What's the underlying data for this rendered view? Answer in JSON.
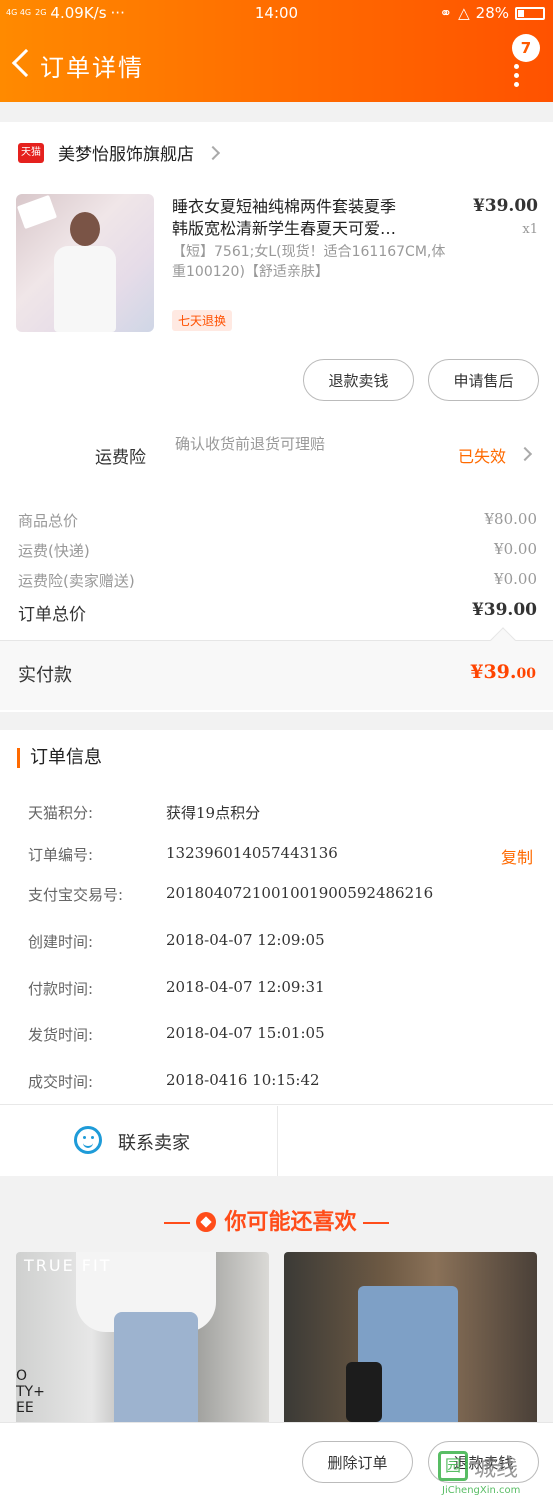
{
  "status_bar": {
    "signal": "4G 4G",
    "signal2": "2G",
    "speed": "4.09K/s",
    "more": "···",
    "time": "14:00",
    "battery": "28%"
  },
  "header": {
    "title": "订单详情",
    "badge_count": "7"
  },
  "shop": {
    "platform_logo": "天猫",
    "name": "美梦怡服饰旗舰店"
  },
  "product": {
    "title_line1": "睡衣女夏短袖纯棉两件套装夏季",
    "title_line2": "韩版宽松清新学生春夏天可爱…",
    "price": "¥39.00",
    "quantity": "x1",
    "sku": "【短】7561;女L(现货！适合161167CM,体重100120)【舒适亲肤】",
    "tag": "七天退换"
  },
  "actions": {
    "refund": "退款卖钱",
    "after_sales": "申请售后"
  },
  "insurance": {
    "label": "运费险",
    "desc": "确认收货前退货可理赔",
    "status": "已失效"
  },
  "summary": {
    "goods_label": "商品总价",
    "goods_value": "¥80.00",
    "shipping_label": "运费(快递)",
    "shipping_value": "¥0.00",
    "ins_label": "运费险(卖家赠送)",
    "ins_value": "¥0.00",
    "total_label": "订单总价",
    "total_value": "¥39.00"
  },
  "payment": {
    "label": "实付款",
    "value_main": "¥39.",
    "value_cents": "00"
  },
  "order_info": {
    "heading": "订单信息",
    "rows": [
      {
        "label": "天猫积分:",
        "value": "获得19点积分"
      },
      {
        "label": "订单编号:",
        "value": "132396014057443136",
        "action": "复制"
      },
      {
        "label": "支付宝交易号:",
        "value": "2018040721001001900592486216"
      },
      {
        "label": "创建时间:",
        "value": "2018-04-07 12:09:05"
      },
      {
        "label": "付款时间:",
        "value": "2018-04-07 12:09:31"
      },
      {
        "label": "发货时间:",
        "value": "2018-04-07 15:01:05"
      },
      {
        "label": "成交时间:",
        "value": "2018-0416 10:15:42"
      }
    ],
    "contact": "联系卖家"
  },
  "recommend": {
    "title": "你可能还喜欢",
    "left_text": "TRUE FIT",
    "left_text2": "O\nTY+\nEE"
  },
  "bottom_bar": {
    "delete": "删除订单",
    "refund": "退款卖钱"
  },
  "watermark": {
    "mark": "园",
    "name": "城线",
    "url": "JiChengXin.com"
  },
  "colors": {
    "accent": "#ff6a00",
    "price_red": "#ff4400",
    "tmall_red": "#e5211e"
  }
}
